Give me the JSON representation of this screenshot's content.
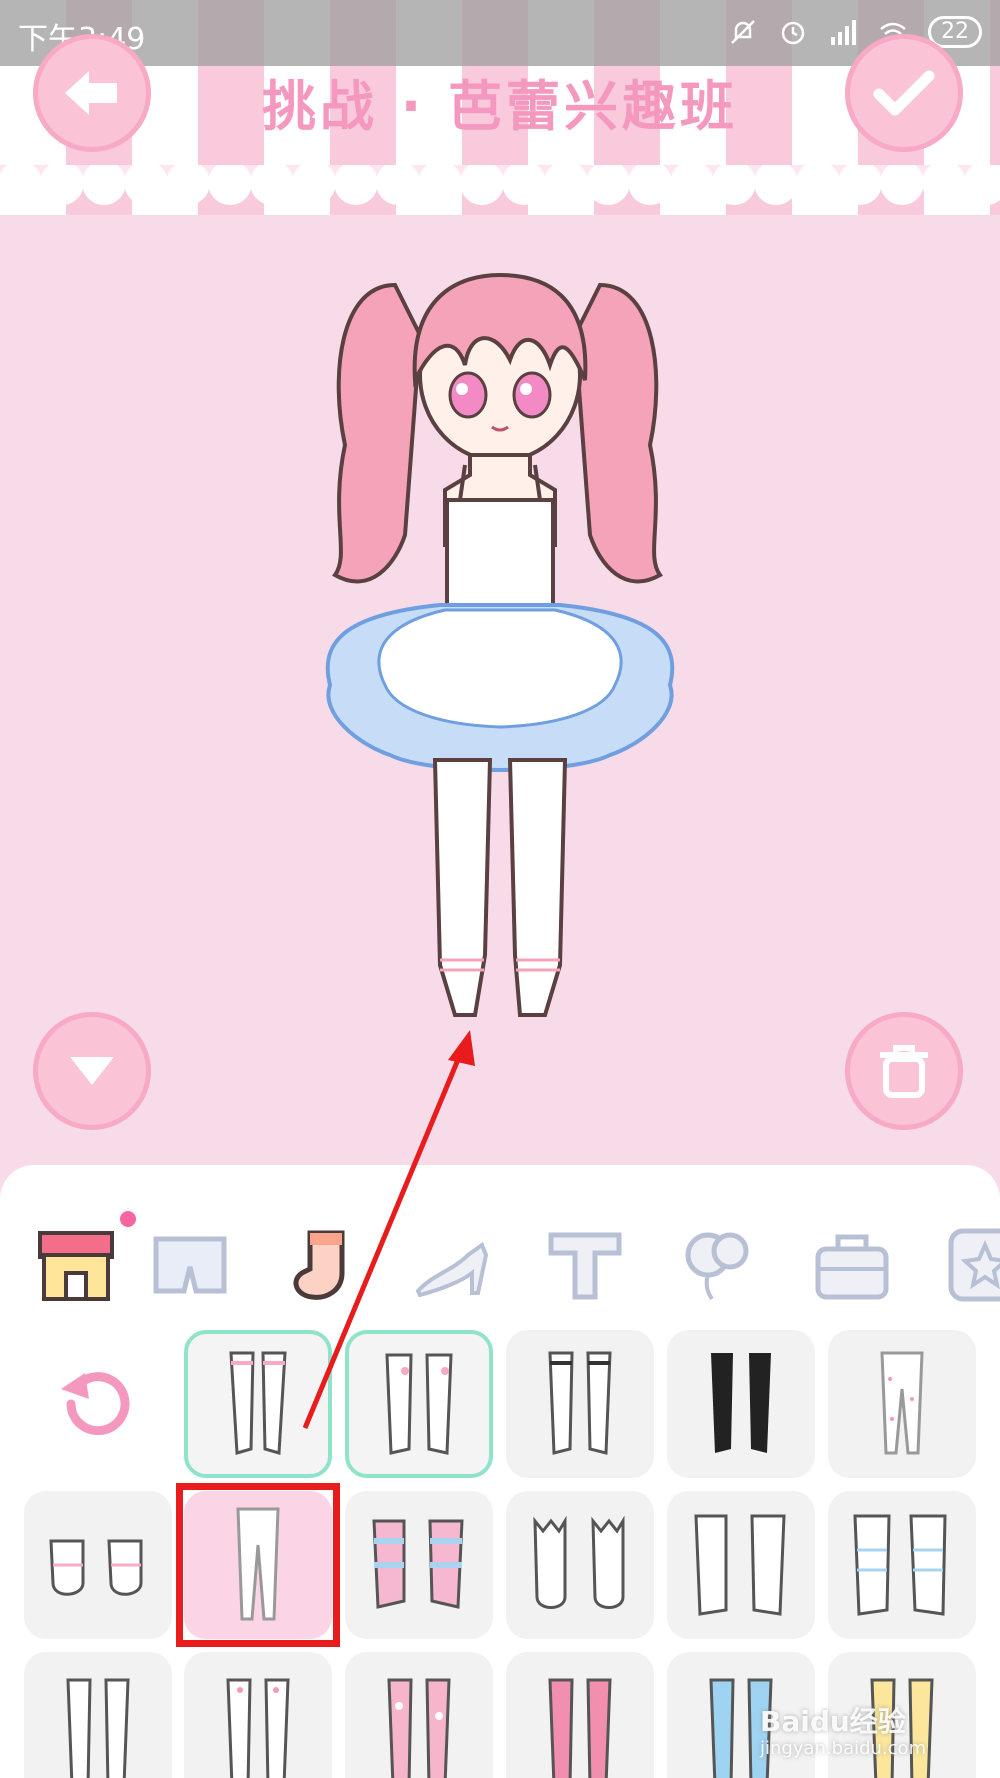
{
  "status_bar": {
    "time": "下午3:49",
    "battery": "22"
  },
  "header": {
    "title": "挑战 · 芭蕾兴趣班"
  },
  "buttons": {
    "back": "back-arrow-icon",
    "confirm": "checkmark-icon",
    "collapse": "triangle-down-icon",
    "delete": "trash-icon",
    "reset": "refresh-icon"
  },
  "categories": [
    {
      "icon": "shop-icon",
      "active": false
    },
    {
      "icon": "shorts-icon",
      "active": false
    },
    {
      "icon": "sock-icon",
      "active": true
    },
    {
      "icon": "high-heel-icon",
      "active": false
    },
    {
      "icon": "hat-icon",
      "active": false
    },
    {
      "icon": "balloon-icon",
      "active": false
    },
    {
      "icon": "bag-icon",
      "active": false
    },
    {
      "icon": "star-frame-icon",
      "active": false
    }
  ],
  "items": [
    {
      "name": "stockings-pink-stripe",
      "state": "owned"
    },
    {
      "name": "stockings-frill-pink",
      "state": "owned"
    },
    {
      "name": "knee-socks-black-stripe",
      "state": "normal"
    },
    {
      "name": "black-stockings",
      "state": "normal"
    },
    {
      "name": "dotted-tights",
      "state": "normal"
    },
    {
      "name": "frill-ankle-socks",
      "state": "normal"
    },
    {
      "name": "white-tights",
      "state": "selected"
    },
    {
      "name": "pink-blue-striped-socks",
      "state": "normal"
    },
    {
      "name": "cat-ear-socks",
      "state": "normal"
    },
    {
      "name": "white-knee-socks",
      "state": "normal"
    },
    {
      "name": "blue-leg-warmers",
      "state": "normal"
    },
    {
      "name": "white-stockings",
      "state": "normal"
    },
    {
      "name": "heart-stockings",
      "state": "normal"
    },
    {
      "name": "pink-dotted-stockings",
      "state": "normal"
    },
    {
      "name": "pink-stockings",
      "state": "normal"
    },
    {
      "name": "blue-stockings",
      "state": "normal"
    },
    {
      "name": "yellow-stockings",
      "state": "normal"
    }
  ],
  "watermark": {
    "main": "Baidu经验",
    "sub": "jingyan.baidu.com"
  },
  "colors": {
    "accent": "#f598bf",
    "highlight": "#e81c1c",
    "owned_border": "#8fe3c8"
  }
}
